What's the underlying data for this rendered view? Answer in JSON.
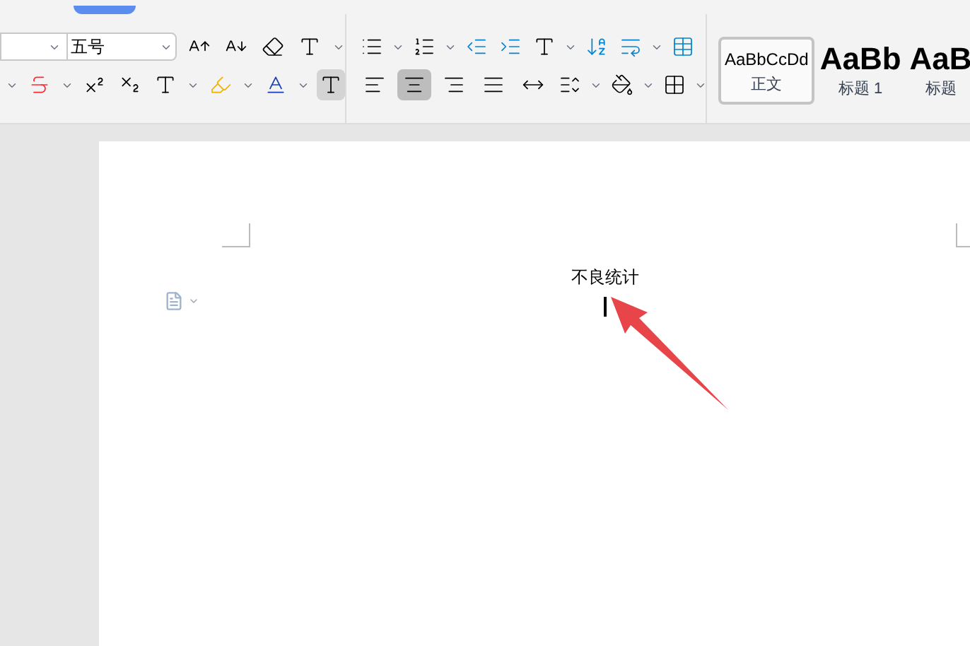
{
  "font": {
    "size": "五号"
  },
  "alignment": [
    {
      "kind": "left",
      "selected": false
    },
    {
      "kind": "center",
      "selected": true
    },
    {
      "kind": "right",
      "selected": false
    },
    {
      "kind": "justify",
      "selected": false
    },
    {
      "kind": "distributed",
      "selected": false
    }
  ],
  "styles": [
    {
      "preview": "AaBbCcDd",
      "label": "正文",
      "kind": "body",
      "selected": true
    },
    {
      "preview": "AaBb",
      "label": "标题 1",
      "kind": "heading",
      "selected": false
    },
    {
      "preview": "AaB",
      "label": "标题",
      "kind": "heading",
      "selected": false
    }
  ],
  "document": {
    "title": "不良统计"
  }
}
